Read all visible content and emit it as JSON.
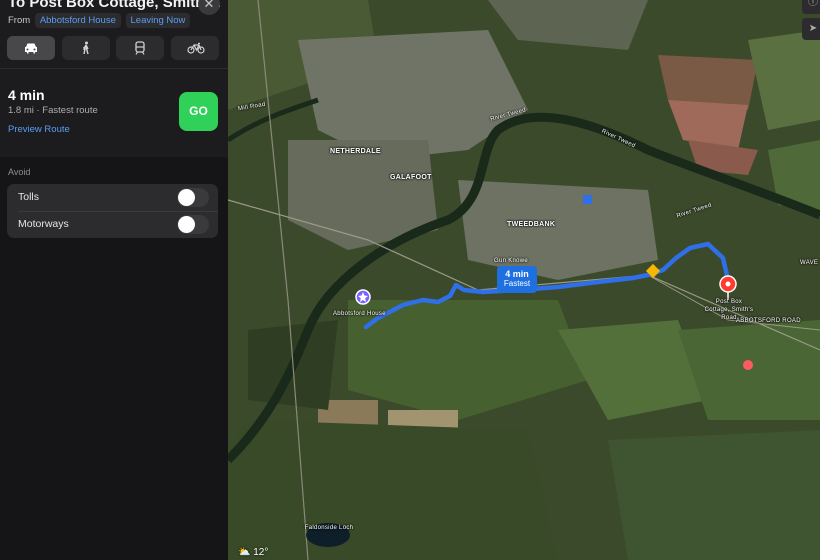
{
  "sidebar": {
    "title": "To Post Box Cottage, Smith ...",
    "from_label": "From",
    "origin": "Abbotsford House",
    "depart": "Leaving Now",
    "modes": [
      {
        "name": "drive",
        "icon": "car-icon",
        "active": true
      },
      {
        "name": "walk",
        "icon": "walking-icon",
        "active": false
      },
      {
        "name": "transit",
        "icon": "train-icon",
        "active": false
      },
      {
        "name": "cycle",
        "icon": "bicycle-icon",
        "active": false
      }
    ],
    "route": {
      "eta": "4 min",
      "detail": "1.8 mi · Fastest route",
      "preview": "Preview Route",
      "go": "GO"
    },
    "avoid": {
      "heading": "Avoid",
      "options": [
        {
          "label": "Tolls",
          "on": false
        },
        {
          "label": "Motorways",
          "on": false
        }
      ]
    }
  },
  "map": {
    "labels": {
      "netherdale": "NETHERDALE",
      "galafoot": "GALAFOOT",
      "tweedbank": "TWEEDBANK",
      "river_tweed_1": "River Tweed",
      "river_tweed_2": "River Tweed",
      "river_tweed_3": "River Tweed",
      "gun_knowe": "Gun Knowe",
      "mill_road": "Mill Road",
      "abbotsford_road": "ABBOTSFORD ROAD",
      "wave": "WAVE",
      "faldonside_loch": "Faldonside Loch"
    },
    "callout": {
      "eta": "4 min",
      "tag": "Fastest"
    },
    "origin_label": "Abbotsford House",
    "destination_label": "Post Box Cottage, Smith's Road",
    "weather": "12°",
    "colors": {
      "route": "#2f6fe8",
      "origin_pin": "#7b61ff",
      "destination_pin": "#ff3b30"
    }
  }
}
